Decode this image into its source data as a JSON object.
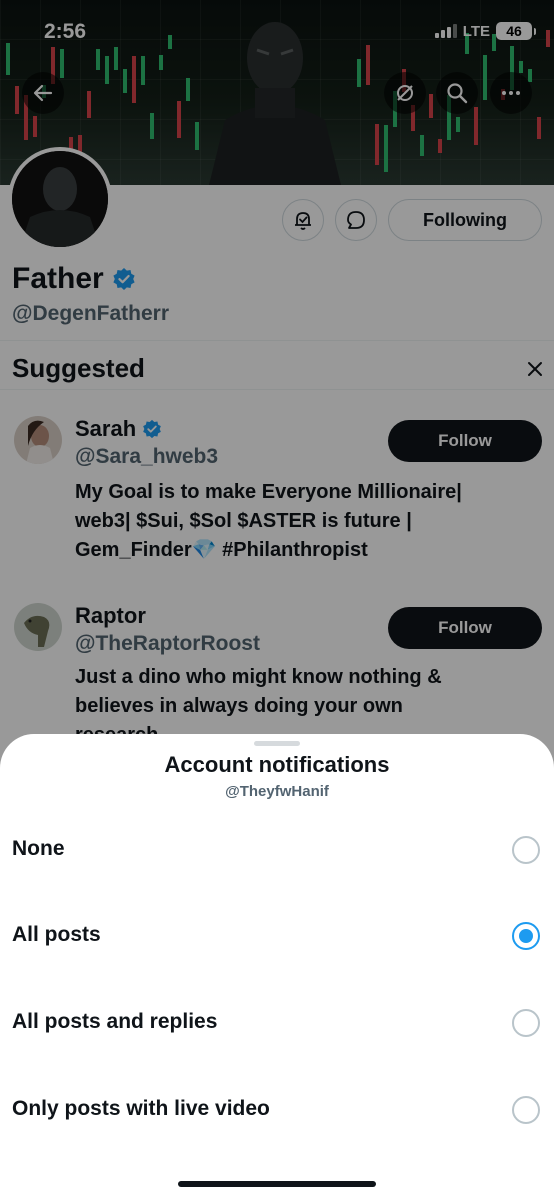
{
  "status_bar": {
    "time": "2:56",
    "network": "LTE",
    "battery": "46"
  },
  "profile": {
    "display_name": "Father",
    "handle": "@DegenFatherr",
    "following_label": "Following"
  },
  "suggested": {
    "title": "Suggested",
    "items": [
      {
        "name": "Sarah",
        "verified": true,
        "handle": "@Sara_hweb3",
        "bio_lines": [
          "My Goal is to make Everyone Millionaire|",
          "web3| $Sui, $Sol $ASTER is future |",
          "Gem_Finder💎 #Philanthropist"
        ],
        "follow_label": "Follow"
      },
      {
        "name": "Raptor",
        "verified": false,
        "handle": "@TheRaptorRoost",
        "bio_lines": [
          "Just a dino who might know nothing &",
          "believes in always doing your own",
          "research"
        ],
        "follow_label": "Follow"
      }
    ]
  },
  "sheet": {
    "title": "Account notifications",
    "subtitle": "@TheyfwHanif",
    "options": [
      {
        "label": "None",
        "selected": false
      },
      {
        "label": "All posts",
        "selected": true
      },
      {
        "label": "All posts and replies",
        "selected": false
      },
      {
        "label": "Only posts with live video",
        "selected": false
      }
    ]
  },
  "colors": {
    "accent": "#1d9bf0",
    "text": "#0f1419",
    "secondary_text": "#536471"
  }
}
